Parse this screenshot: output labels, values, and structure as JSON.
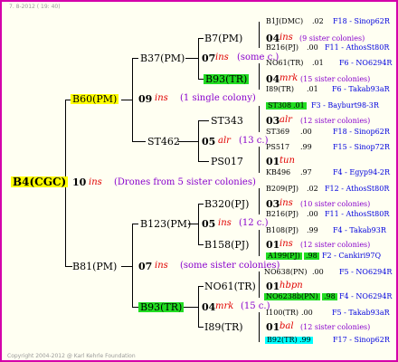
{
  "header": "7.  8-2012 ( 19: 40)",
  "footer": "Copyright 2004-2012 @ Karl Kehrle Foundation",
  "root": {
    "label": "B4(CGC)",
    "num": "10",
    "ins": "ins",
    "note": "(Drones from 5 sister colonies)"
  },
  "gen1": {
    "top": {
      "label": "B60(PM)",
      "num": "09",
      "ins": "ins",
      "note": "(1 single colony)"
    },
    "bottom": {
      "label": "B81(PM)",
      "num": "07",
      "ins": "ins",
      "note": "(some sister colonies)"
    }
  },
  "gen2": {
    "a": {
      "label": "B37(PM)",
      "num": "07",
      "ins": "ins",
      "note": "(some c.)"
    },
    "b": {
      "label": "ST462",
      "num": "05",
      "ins": "alr",
      "note": "(13 c.)"
    },
    "c": {
      "label": "B123(PM)",
      "num": "05",
      "ins": "ins",
      "note": "(12 c.)"
    },
    "d": {
      "label": "B93(TR)",
      "num": "04",
      "ins": "mrk",
      "note": "(15 c.)"
    }
  },
  "gen3": {
    "a1": {
      "label": "B7(PM)",
      "num": "04",
      "ins": "ins",
      "note": "(9 sister colonies)"
    },
    "a2": {
      "label": "B93(TR)",
      "num": "04",
      "ins": "mrk",
      "note": "(15 sister colonies)"
    },
    "b1": {
      "label": "ST343",
      "num": "03",
      "ins": "alr",
      "note": "(12 sister colonies)"
    },
    "b2": {
      "label": "PS017",
      "num": "01",
      "ins": "tun",
      "note": ""
    },
    "c1": {
      "label": "B320(PJ)",
      "num": "03",
      "ins": "ins",
      "note": "(10 sister colonies)"
    },
    "c2": {
      "label": "B158(PJ)",
      "num": "01",
      "ins": "ins",
      "note": "(12 sister colonies)"
    },
    "d1": {
      "label": "NO61(TR)",
      "num": "01",
      "ins": "hbpn",
      "note": ""
    },
    "d2": {
      "label": "I89(TR)",
      "num": "01",
      "ins": "bal",
      "note": "(12 sister colonies)"
    }
  },
  "gen4": [
    {
      "label": "B1J(DMC)",
      "val": ".02",
      "ped": "F18 - Sinop62R"
    },
    {
      "label": "B216(PJ)",
      "val": ".00",
      "ped": "F11 - AthosSt80R"
    },
    {
      "label": "NO61(TR)",
      "val": ".01",
      "ped": "F6 - NO6294R"
    },
    {
      "label": "I89(TR)",
      "val": ".01",
      "ped": "F6 - Takab93aR"
    },
    {
      "label": "ST308",
      "val": ".01",
      "ped": "F3 - Bayburt98-3R"
    },
    {
      "label": "ST369",
      "val": ".00",
      "ped": "F18 - Sinop62R"
    },
    {
      "label": "PS517",
      "val": ".99",
      "ped": "F15 - Sinop72R"
    },
    {
      "label": "KB496",
      "val": ".97",
      "ped": "F4 - Egyp94-2R"
    },
    {
      "label": "B209(PJ)",
      "val": ".02",
      "ped": "F12 - AthosSt80R"
    },
    {
      "label": "B216(PJ)",
      "val": ".00",
      "ped": "F11 - AthosSt80R"
    },
    {
      "label": "B108(PJ)",
      "val": ".99",
      "ped": "F4 - Takab93R"
    },
    {
      "label": "A199(PJ)",
      "val": ".98",
      "ped": "F2 - Cankiri97Q"
    },
    {
      "label": "NO638(PN)",
      "val": ".00",
      "ped": "F5 - NO6294R"
    },
    {
      "label": "NO6238b(PN)",
      "val": ".98",
      "ped": "F4 - NO6294R"
    },
    {
      "label": "I100(TR)",
      "val": ".00",
      "ped": "F5 - Takab93aR"
    },
    {
      "label": "B92(TR)",
      "val": ".99",
      "ped": "F17 - Sinop62R"
    }
  ]
}
